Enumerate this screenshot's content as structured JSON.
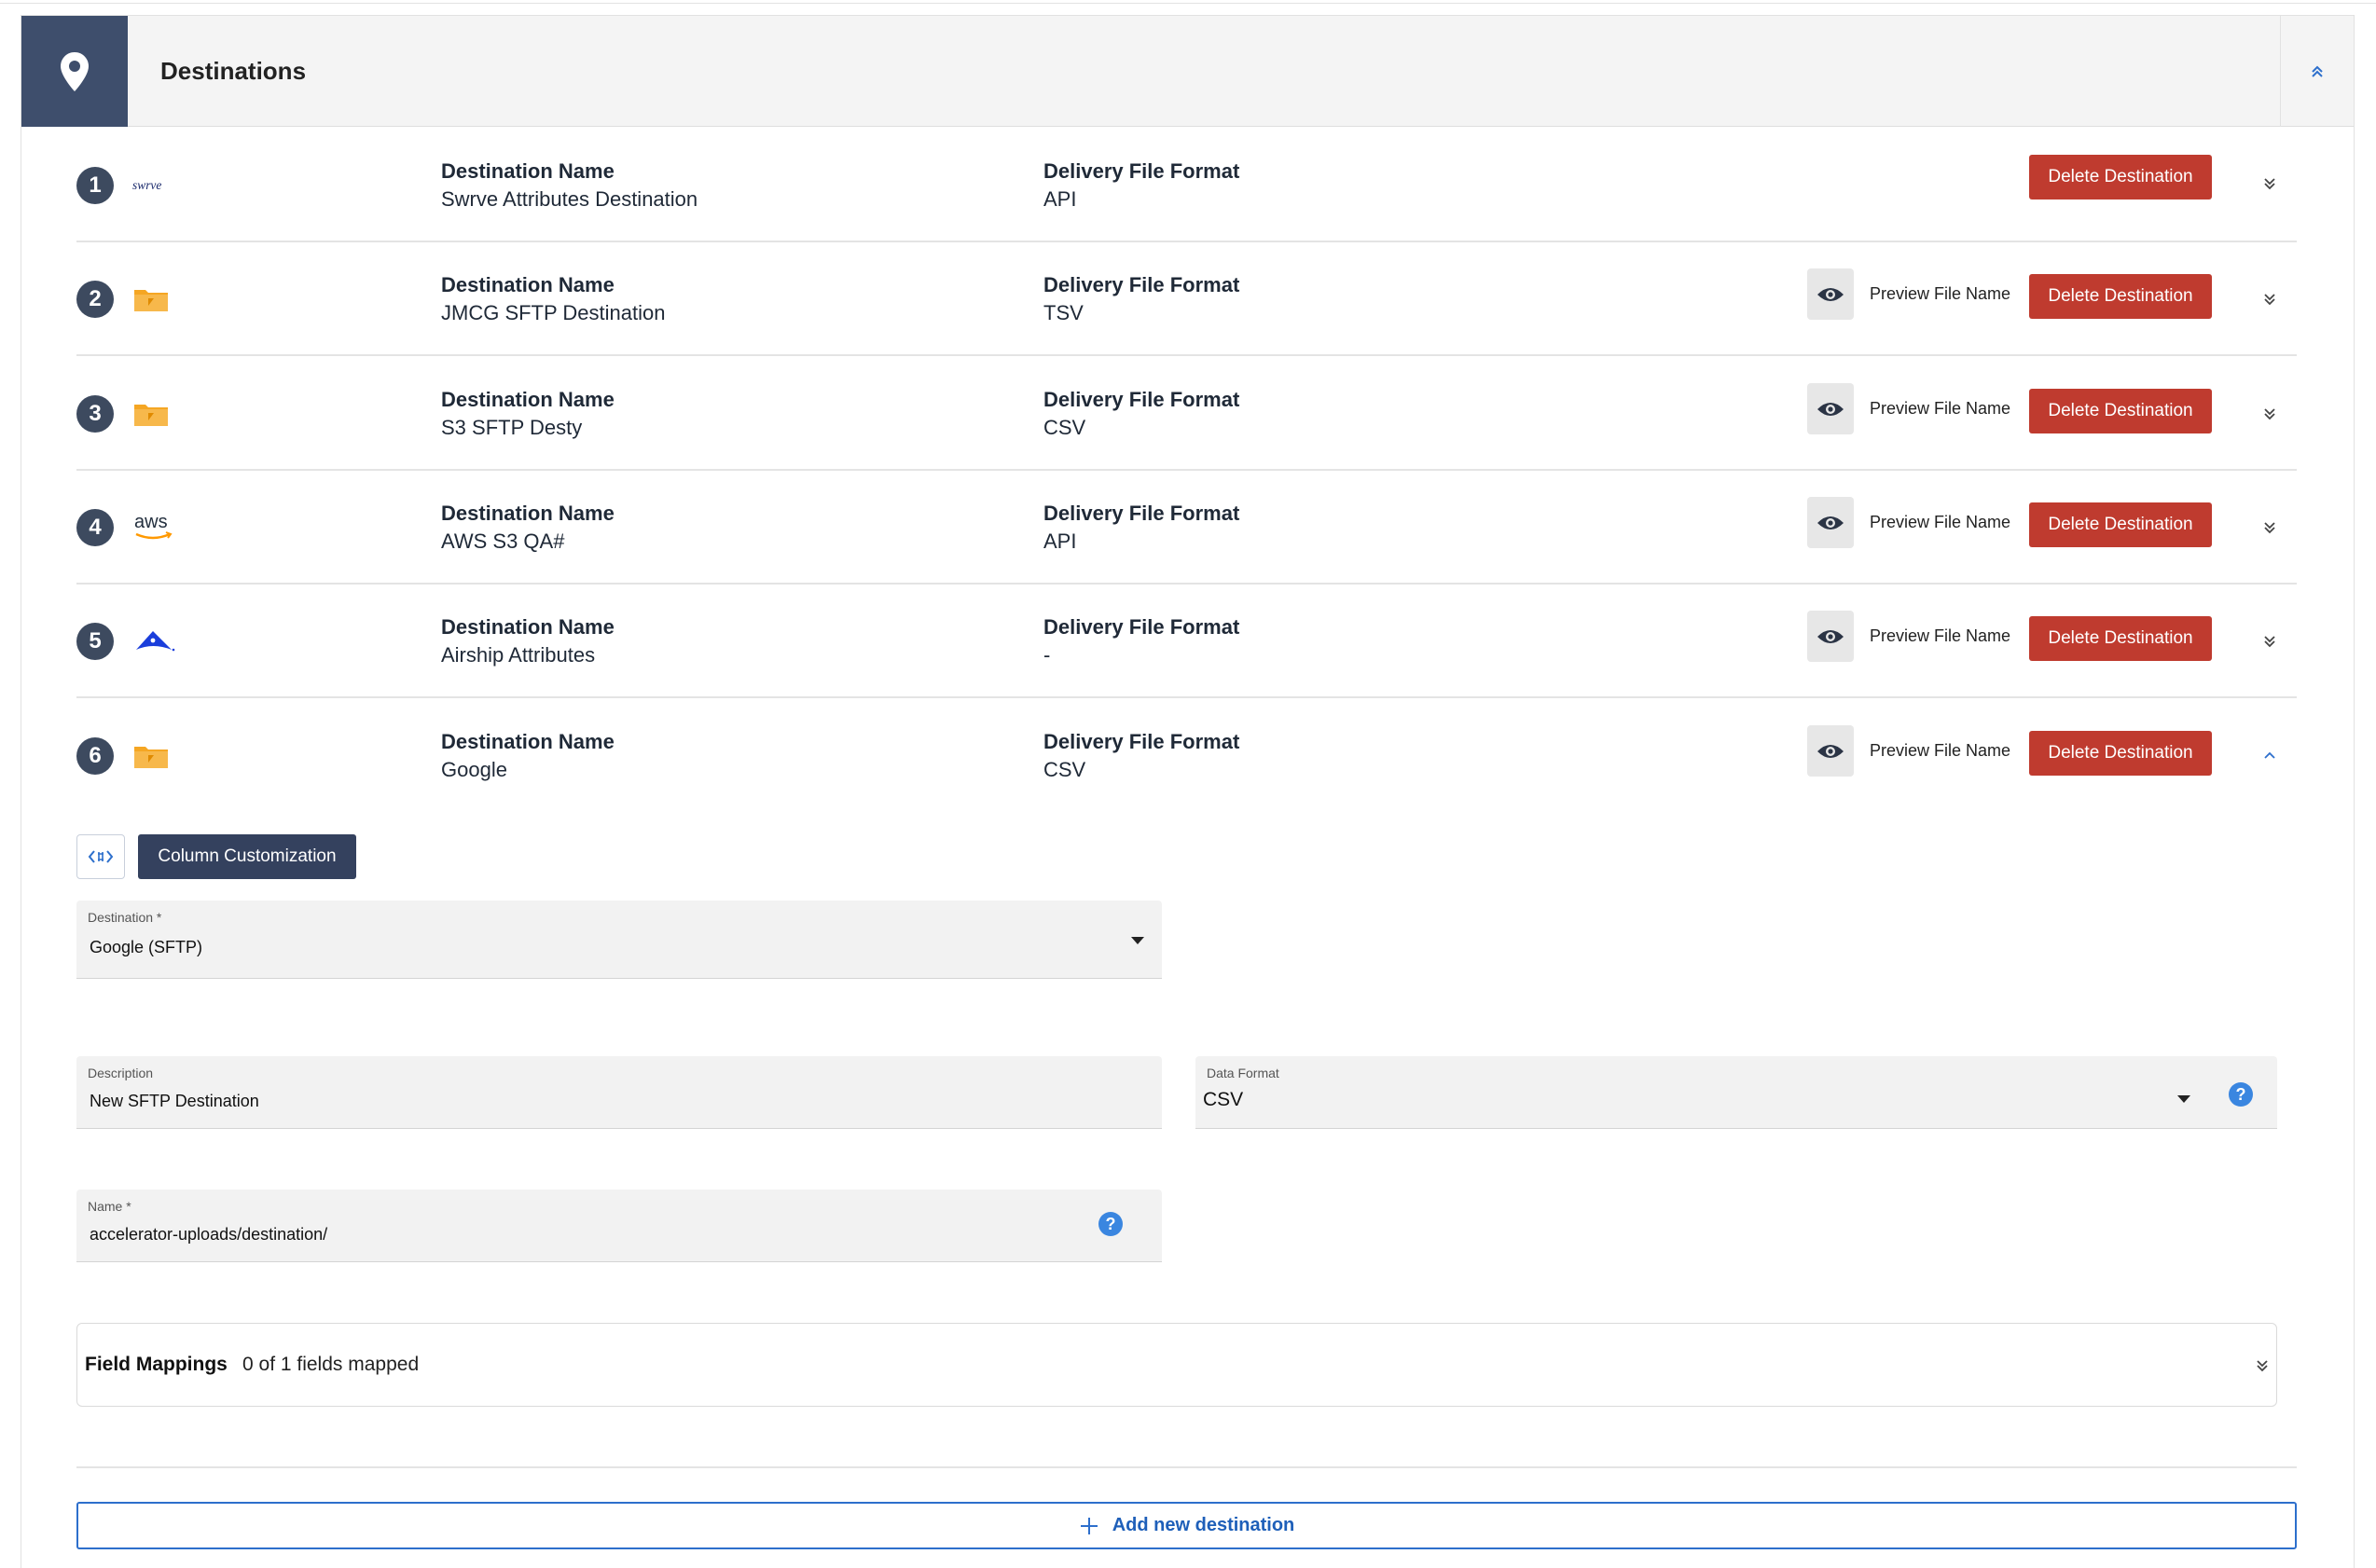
{
  "section": {
    "title": "Destinations",
    "icon": "location-pin-icon"
  },
  "destinations": [
    {
      "num": "1",
      "logo": "swrve-logo",
      "logo_text": "swrve",
      "name_label": "Destination Name",
      "name": "Swrve Attributes Destination",
      "format_label": "Delivery File Format",
      "format": "API",
      "preview": false,
      "delete_label": "Delete Destination",
      "expanded": false
    },
    {
      "num": "2",
      "logo": "sftp-folder-icon",
      "name_label": "Destination Name",
      "name": "JMCG SFTP Destination",
      "format_label": "Delivery File Format",
      "format": "TSV",
      "preview": true,
      "preview_label": "Preview File Name",
      "delete_label": "Delete Destination",
      "expanded": false
    },
    {
      "num": "3",
      "logo": "sftp-folder-icon",
      "name_label": "Destination Name",
      "name": "S3 SFTP Desty",
      "format_label": "Delivery File Format",
      "format": "CSV",
      "preview": true,
      "preview_label": "Preview File Name",
      "delete_label": "Delete Destination",
      "expanded": false
    },
    {
      "num": "4",
      "logo": "aws-logo",
      "logo_text": "aws",
      "name_label": "Destination Name",
      "name": "AWS S3 QA#",
      "format_label": "Delivery File Format",
      "format": "API",
      "preview": true,
      "preview_label": "Preview File Name",
      "delete_label": "Delete Destination",
      "expanded": false
    },
    {
      "num": "5",
      "logo": "airship-logo",
      "name_label": "Destination Name",
      "name": "Airship Attributes",
      "format_label": "Delivery File Format",
      "format": "-",
      "preview": true,
      "preview_label": "Preview File Name",
      "delete_label": "Delete Destination",
      "expanded": false
    },
    {
      "num": "6",
      "logo": "sftp-folder-icon",
      "name_label": "Destination Name",
      "name": "Google",
      "format_label": "Delivery File Format",
      "format": "CSV",
      "preview": true,
      "preview_label": "Preview File Name",
      "delete_label": "Delete Destination",
      "expanded": true
    }
  ],
  "expanded_form": {
    "column_customization_label": "Column Customization",
    "destination": {
      "label": "Destination *",
      "value": "Google (SFTP)"
    },
    "description": {
      "label": "Description",
      "value": "New SFTP Destination"
    },
    "data_format": {
      "label": "Data Format",
      "value": "CSV"
    },
    "name": {
      "label": "Name *",
      "value": "accelerator-uploads/destination/"
    },
    "field_mappings": {
      "label": "Field Mappings",
      "count": "0 of 1 fields mapped"
    }
  },
  "add_destination_label": "Add new destination",
  "colors": {
    "primary": "#34415e",
    "danger": "#bf3b2f",
    "link": "#1e5fb9",
    "help": "#3a86e0",
    "folder": "#f5a623"
  }
}
